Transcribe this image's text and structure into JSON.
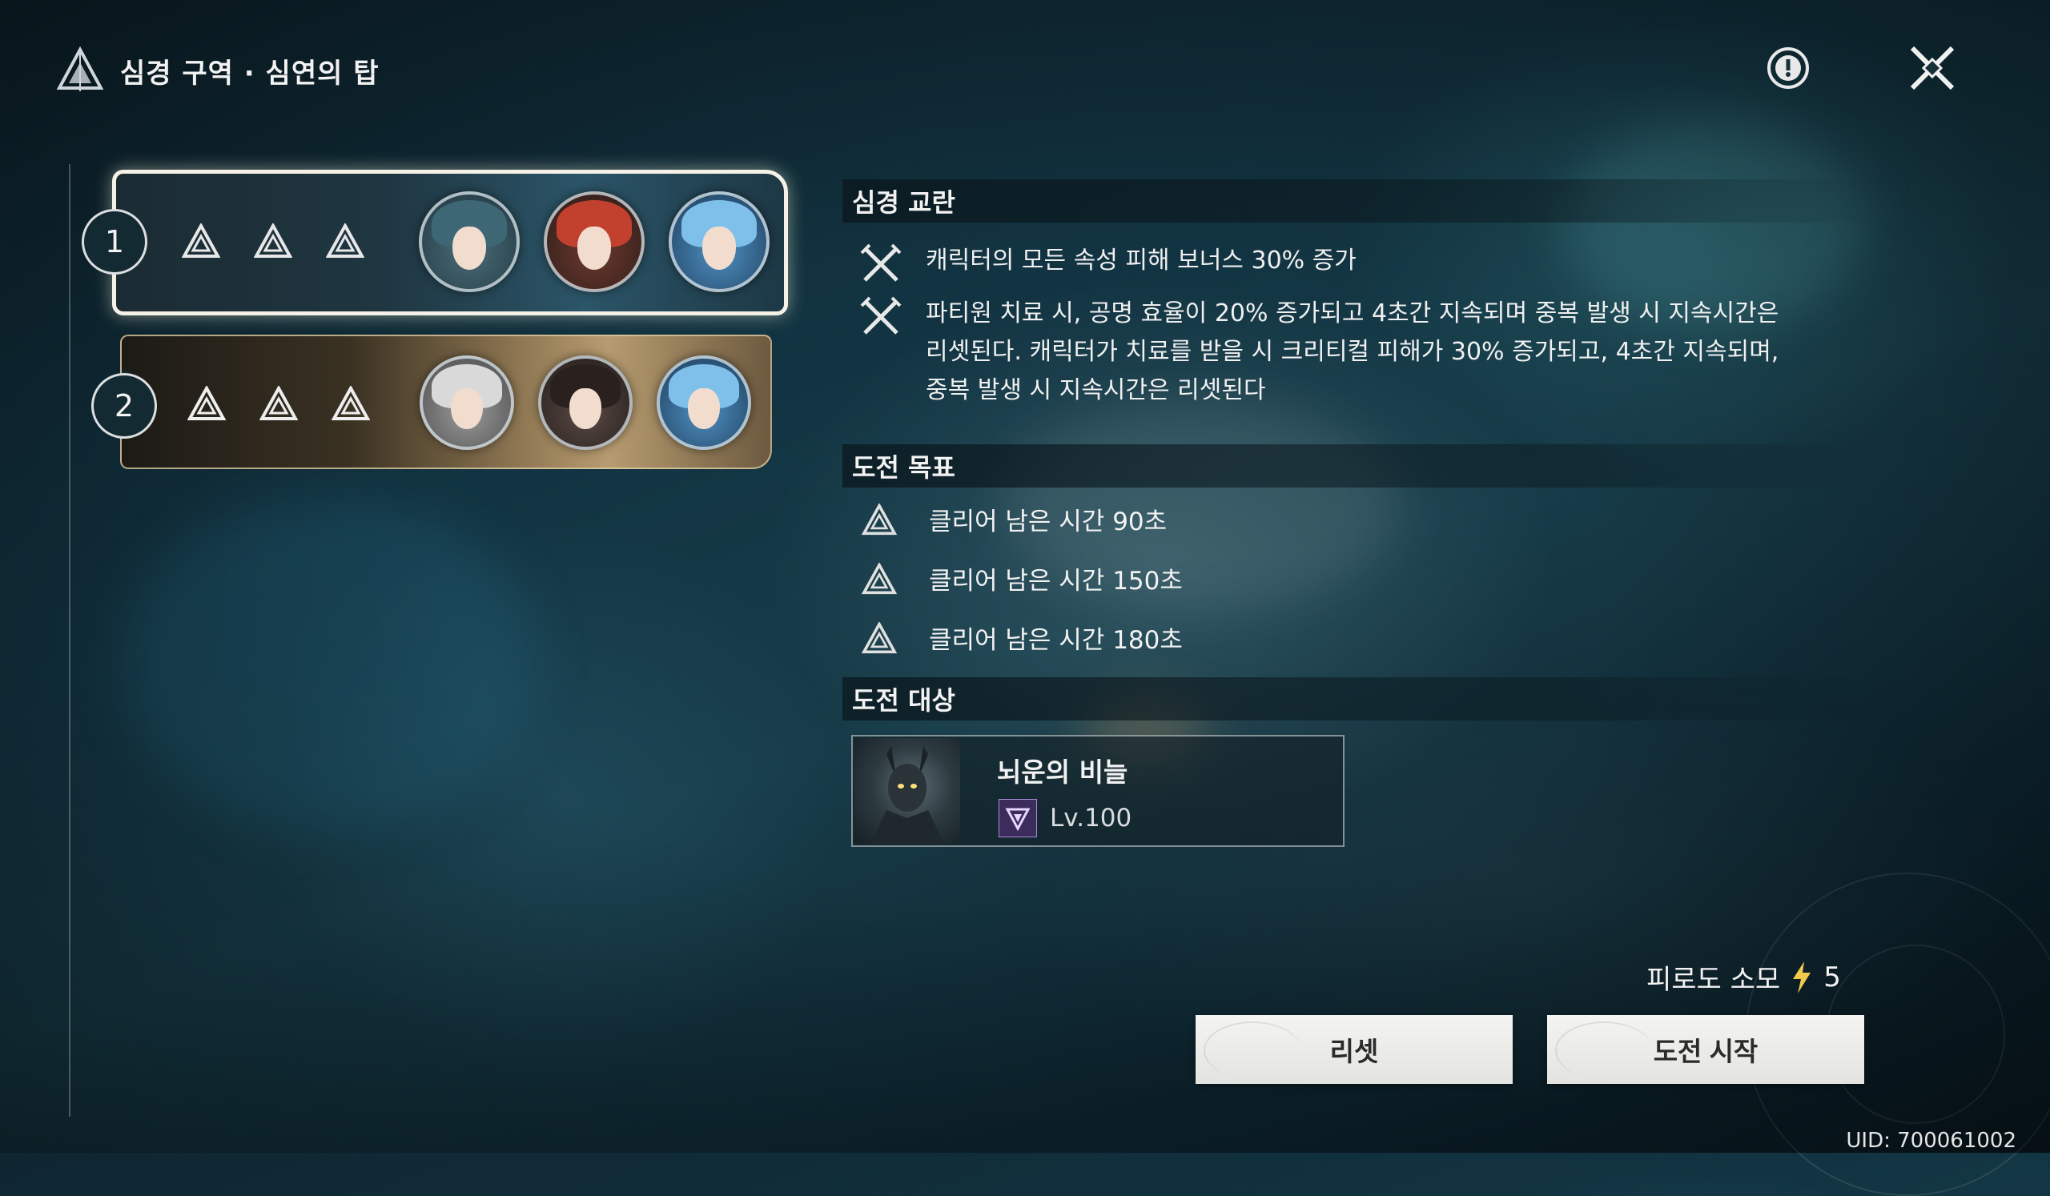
{
  "header": {
    "title": "심경 구역 · 심연의 탑",
    "help_icon": "exclamation-circle-icon",
    "close_icon": "close-x-icon"
  },
  "stages": [
    {
      "number": "1",
      "selected": true,
      "stars_icon": "triangle-star-icon",
      "star_count": 3
    },
    {
      "number": "2",
      "selected": false,
      "stars_icon": "triangle-star-icon",
      "star_count": 3
    }
  ],
  "disturbance": {
    "title": "심경 교란",
    "effects": [
      "캐릭터의 모든 속성 피해 보너스 30% 증가",
      "파티원 치료 시, 공명 효율이 20% 증가되고 4초간 지속되며 중복 발생 시 지속시간은\n리셋된다. 캐릭터가 치료를 받을 시 크리티컬 피해가 30% 증가되고, 4초간 지속되며,\n중복 발생 시 지속시간은 리셋된다"
    ]
  },
  "goals": {
    "title": "도전 목표",
    "items": [
      "클리어 남은 시간 90초",
      "클리어 남은 시간 150초",
      "클리어 남은 시간 180초"
    ]
  },
  "target": {
    "title": "도전 대상",
    "name": "뇌운의 비늘",
    "level": "Lv.100"
  },
  "stamina": {
    "label": "피로도 소모",
    "value": "5"
  },
  "buttons": {
    "reset": "리셋",
    "start": "도전 시작"
  },
  "uid": "UID: 700061002",
  "colors": {
    "accent_gold": "#f2c94c",
    "button_bg": "#f0f0ed",
    "panel_bg": "#0f2631"
  }
}
